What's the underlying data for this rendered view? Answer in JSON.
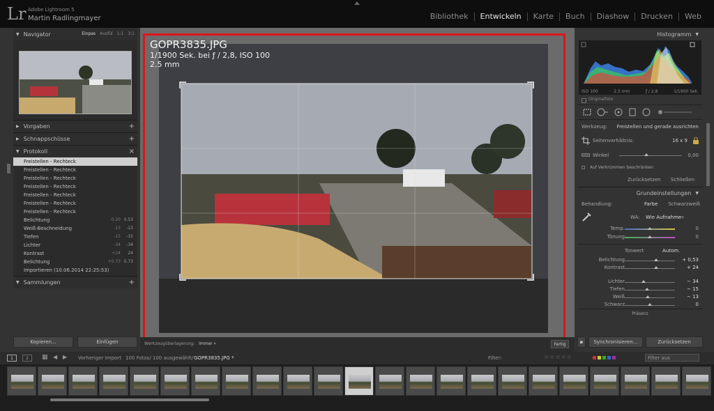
{
  "app": {
    "product": "Adobe Lightroom 5",
    "user": "Martin Radlingmayer",
    "logo": "Lr"
  },
  "modules": [
    "Bibliothek",
    "Entwickeln",
    "Karte",
    "Buch",
    "Diashow",
    "Drucken",
    "Web"
  ],
  "active_module": "Entwickeln",
  "left": {
    "navigator": {
      "title": "Navigator",
      "options": [
        "Einpas",
        "Ausfül",
        "1:1",
        "3:1"
      ]
    },
    "vorgaben": "Vorgaben",
    "schnappschuesse": "Schnappschüsse",
    "protokoll": "Protokoll",
    "history": [
      {
        "label": "Freistellen - Rechteck",
        "v1": "",
        "v2": ""
      },
      {
        "label": "Freistellen - Rechteck",
        "v1": "",
        "v2": ""
      },
      {
        "label": "Freistellen - Rechteck",
        "v1": "",
        "v2": ""
      },
      {
        "label": "Freistellen - Rechteck",
        "v1": "",
        "v2": ""
      },
      {
        "label": "Freistellen - Rechteck",
        "v1": "",
        "v2": ""
      },
      {
        "label": "Freistellen - Rechteck",
        "v1": "",
        "v2": ""
      },
      {
        "label": "Freistellen - Rechteck",
        "v1": "",
        "v2": ""
      },
      {
        "label": "Belichtung",
        "v1": "-0.20",
        "v2": "0.53"
      },
      {
        "label": "Weiß-Beschneidung",
        "v1": "-13",
        "v2": "-13"
      },
      {
        "label": "Tiefen",
        "v1": "-15",
        "v2": "-15"
      },
      {
        "label": "Lichter",
        "v1": "-34",
        "v2": "-34"
      },
      {
        "label": "Kontrast",
        "v1": "+24",
        "v2": "24"
      },
      {
        "label": "Belichtung",
        "v1": "+0.73",
        "v2": "0.73"
      },
      {
        "label": "Importieren (10.06.2014 22:25:53)",
        "v1": "",
        "v2": ""
      }
    ],
    "sammlungen": "Sammlungen",
    "copy_btn": "Kopieren...",
    "paste_btn": "Einfügen"
  },
  "center": {
    "filename": "GOPR3835.JPG",
    "exposure": "1/1900 Sek. bei ƒ / 2,8, ISO 100",
    "focal": "2.5 mm",
    "tool_overlay_label": "Werkzeugüberlagerung:",
    "tool_overlay_value": "Immer",
    "done": "Fertig"
  },
  "right": {
    "histogram": "Histogramm",
    "hist_labels": [
      "ISO 100",
      "2.5 mm",
      "ƒ / 2,8",
      "1/1900 Sek."
    ],
    "originalfoto": "Originalfoto",
    "werkzeug_label": "Werkzeug:",
    "werkzeug_value": "Freistellen und gerade ausrichten",
    "seitenverhaeltnis": "Seitenverhältnis:",
    "ratio": "16 x 9",
    "winkel": "Winkel",
    "winkel_val": "0,00",
    "verkruemmen": "Auf Verkrümmen beschränken",
    "reset": "Zurücksetzen",
    "close": "Schließen",
    "grundeinstellungen": "Grundeinstellungen",
    "behandlung": "Behandlung:",
    "farbe": "Farbe",
    "schwarzweiss": "Schwarzweiß",
    "wa": "WA:",
    "wa_val": "Wie Aufnahme",
    "temp": "Temp.",
    "temp_val": "0",
    "toenung": "Tönung",
    "toenung_val": "0",
    "tonwert": "Tonwert",
    "autom": "Autom.",
    "belichtung": "Belichtung",
    "belichtung_val": "+ 0,53",
    "kontrast": "Kontrast",
    "kontrast_val": "+ 24",
    "lichter": "Lichter",
    "lichter_val": "− 34",
    "tiefen": "Tiefen",
    "tiefen_val": "− 15",
    "weiss": "Weiß",
    "weiss_val": "− 13",
    "schwarz": "Schwarz",
    "schwarz_val": "0",
    "praesenz": "Präsenz",
    "sync": "Synchronisieren...",
    "reset2": "Zurücksetzen"
  },
  "filmbar": {
    "page1": "1",
    "page2": "2",
    "source": "Vorheriger Import",
    "count": "100 Fotos/ 100 ausgewählt/",
    "file": "GOPR3835.JPG",
    "filter": "Filter:",
    "filter_off": "Filter aus"
  },
  "colors": {
    "highlight": "#e0141b",
    "active_history": "#cfcfcf"
  }
}
